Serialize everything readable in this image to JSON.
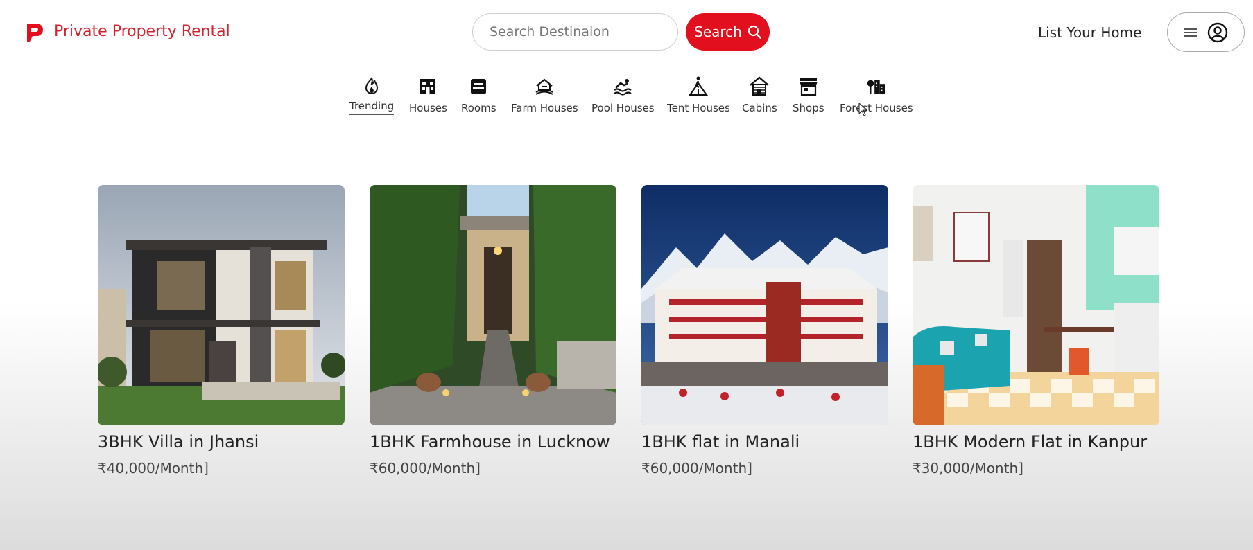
{
  "header": {
    "brand": "Private Property Rental",
    "search_placeholder": "Search Destinaion",
    "search_button": "Search",
    "list_home": "List Your Home"
  },
  "categories": [
    {
      "label": "Trending",
      "icon": "flame-icon",
      "active": true
    },
    {
      "label": "Houses",
      "icon": "house-icon"
    },
    {
      "label": "Rooms",
      "icon": "bed-icon"
    },
    {
      "label": "Farm Houses",
      "icon": "farm-house-icon"
    },
    {
      "label": "Pool Houses",
      "icon": "swimming-icon"
    },
    {
      "label": "Tent Houses",
      "icon": "tent-icon"
    },
    {
      "label": "Cabins",
      "icon": "cabin-icon"
    },
    {
      "label": "Shops",
      "icon": "shop-icon"
    },
    {
      "label": "Forest Houses",
      "icon": "forest-house-icon"
    }
  ],
  "listings": [
    {
      "title": "3BHK Villa in Jhansi",
      "price": "₹40,000/Month]"
    },
    {
      "title": "1BHK Farmhouse in Lucknow",
      "price": "₹60,000/Month]"
    },
    {
      "title": "1BHK flat in Manali",
      "price": "₹60,000/Month]"
    },
    {
      "title": "1BHK Modern Flat in Kanpur",
      "price": "₹30,000/Month]"
    }
  ],
  "colors": {
    "accent": "#e20f1e",
    "brand": "#d2232f"
  }
}
